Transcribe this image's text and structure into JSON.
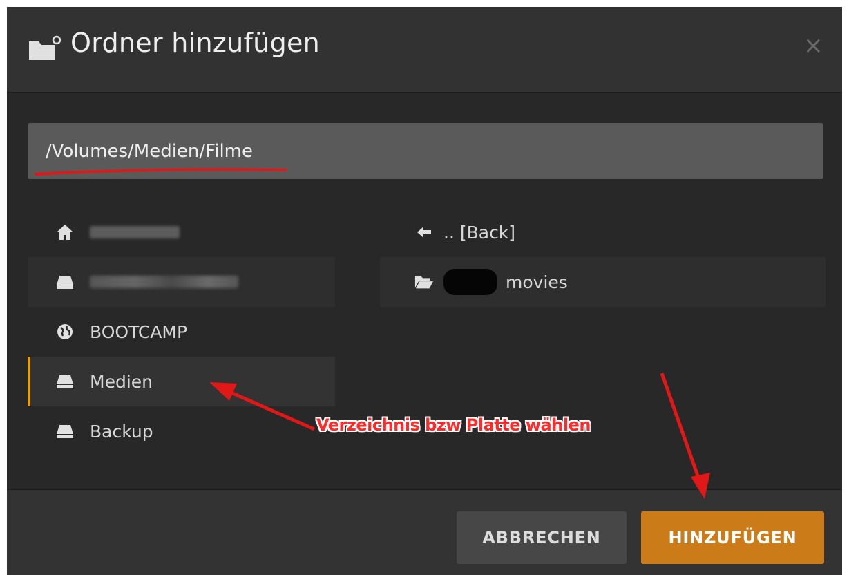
{
  "dialog": {
    "title": "Ordner hinzufügen",
    "header_icon": "folder-plus-icon",
    "close_icon": "close-icon",
    "close_label": "×"
  },
  "path_input": {
    "value": "/Volumes/Medien/Filme"
  },
  "left_list": {
    "items": [
      {
        "icon": "home-icon",
        "label": "",
        "redacted": true
      },
      {
        "icon": "drive-icon",
        "label": "",
        "redacted": true
      },
      {
        "icon": "globe-icon",
        "label": "BOOTCAMP"
      },
      {
        "icon": "drive-icon",
        "label": "Medien",
        "selected": true
      },
      {
        "icon": "drive-icon",
        "label": "Backup"
      }
    ]
  },
  "right_list": {
    "items": [
      {
        "icon": "arrow-left-icon",
        "label": ".. [Back]"
      },
      {
        "icon": "folder-open-icon",
        "label": "movies",
        "redacted_prefix": true
      }
    ]
  },
  "footer": {
    "cancel_label": "ABBRECHEN",
    "add_label": "HINZUFÜGEN"
  },
  "annotation": {
    "text": "Verzeichnis bzw Platte wählen",
    "color": "#ff2a2a"
  },
  "colors": {
    "accent": "#e5a00d",
    "primary_button": "#cc7b19",
    "dialog_bg": "#282828"
  }
}
